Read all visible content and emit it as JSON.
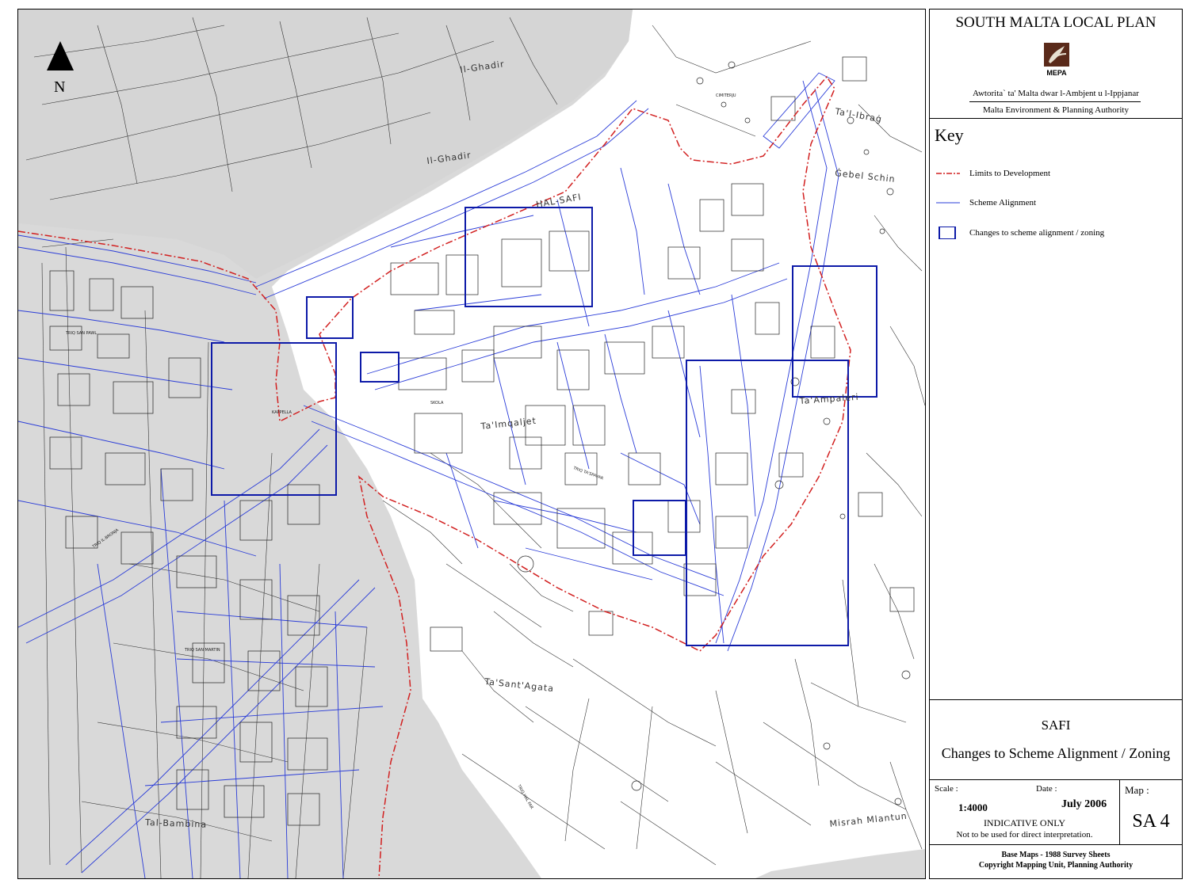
{
  "map": {
    "north_label": "N",
    "place_labels": [
      "Il-Ghadir",
      "Il-Ghadir",
      "HAL-SAFI",
      "Ta'l-Ibraġ",
      "Ġebel Schin",
      "Ta'Imqaljet",
      "Ta'Ampaleri",
      "Ta'Sant'Agata",
      "Tal-Bambina",
      "Misrah Mlantun"
    ],
    "street_labels": [
      "TRIQ IL-BRONJA",
      "TRIQ SAN MARTIN",
      "TRIQ SAN PAWL",
      "TRIQ TA'SPAVAR",
      "KAPPELLA",
      "SKOLA",
      "CIMITERJU",
      "TRIQ HAL FAR"
    ],
    "colors": {
      "urban_fill": "#d9d9d9",
      "limits_line": "#d22020",
      "scheme_line": "#2a3cd8",
      "changes_box": "#0d1aa8",
      "base_line": "#222222"
    }
  },
  "panel": {
    "title": "SOUTH MALTA LOCAL PLAN",
    "logo_text": "MEPA",
    "authority_maltese": "Awtorita` ta' Malta dwar l-Ambjent u l-Ippjanar",
    "authority_english": "Malta Environment & Planning Authority",
    "key_title": "Key",
    "key_items": [
      {
        "label": "Limits to Development",
        "icon": "dash-dot-red-line"
      },
      {
        "label": "Scheme Alignment",
        "icon": "thin-blue-line"
      },
      {
        "label": "Changes to scheme alignment / zoning",
        "icon": "blue-square-outline"
      }
    ],
    "place": "SAFI",
    "subtitle": "Changes to Scheme Alignment / Zoning",
    "scale_label": "Scale :",
    "scale_value": "1:4000",
    "date_label": "Date :",
    "date_value": "July 2006",
    "indicative": "INDICATIVE ONLY",
    "not_used": "Not to be used for direct interpretation.",
    "map_label": "Map :",
    "map_value": "SA 4",
    "base_maps": "Base Maps - 1988 Survey Sheets",
    "copyright": "Copyright Mapping Unit, Planning Authority"
  }
}
